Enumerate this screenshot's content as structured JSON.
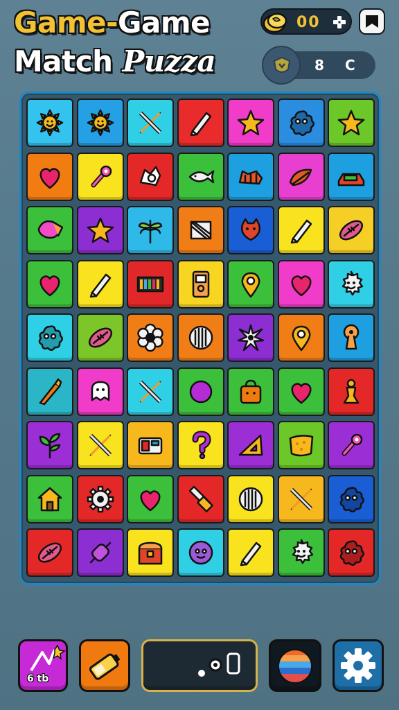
{
  "header": {
    "title_line1_a": "Game-",
    "title_line1_b": "Game",
    "title_line2_a": "Match ",
    "title_line2_b": "Puzza",
    "coins": "00",
    "coin_icon": "coin-stack-icon",
    "plus_icon": "plus-icon",
    "flag_icon": "flag-icon",
    "level_badge_icon": "shield-icon",
    "level_left": "8",
    "level_right": "C"
  },
  "board": {
    "rows": 9,
    "cols": 7,
    "tiles": [
      [
        "#34c3ee",
        "sun"
      ],
      [
        "#26a0e4",
        "sun"
      ],
      [
        "#2fd0e6",
        "cross-tools"
      ],
      [
        "#e92b2b",
        "pencil"
      ],
      [
        "#f03cc8",
        "star"
      ],
      [
        "#2a8de0",
        "blob"
      ],
      [
        "#6cc728",
        "star"
      ],
      [
        "#f17d12",
        "heart"
      ],
      [
        "#f9e21e",
        "wrench"
      ],
      [
        "#e42828",
        "dragon"
      ],
      [
        "#3cbf3a",
        "fish"
      ],
      [
        "#1e9fe0",
        "dog"
      ],
      [
        "#e83fd0",
        "leaf"
      ],
      [
        "#1e9fe0",
        "car"
      ],
      [
        "#3cbf3a",
        "shell"
      ],
      [
        "#8d2ed2",
        "star"
      ],
      [
        "#2fb9e8",
        "dragonfly"
      ],
      [
        "#f07d16",
        "box"
      ],
      [
        "#1a5ed6",
        "cat"
      ],
      [
        "#f9e21e",
        "pencil"
      ],
      [
        "#f5cf25",
        "football"
      ],
      [
        "#3cbf3a",
        "heart"
      ],
      [
        "#f9e21e",
        "pencil"
      ],
      [
        "#e12828",
        "bars"
      ],
      [
        "#f7d521",
        "phone"
      ],
      [
        "#3cbf3a",
        "pin"
      ],
      [
        "#f03cc8",
        "heart"
      ],
      [
        "#2fd0e6",
        "gear-face"
      ],
      [
        "#2fd0e6",
        "blob"
      ],
      [
        "#7cc62a",
        "football"
      ],
      [
        "#f07d16",
        "flower"
      ],
      [
        "#f07d16",
        "grill"
      ],
      [
        "#8d2ed2",
        "burst"
      ],
      [
        "#f07d16",
        "pin"
      ],
      [
        "#1e9fe0",
        "keyhole"
      ],
      [
        "#2bb6c8",
        "crayon"
      ],
      [
        "#f03cc8",
        "ghost"
      ],
      [
        "#2fd0e6",
        "cross-tools"
      ],
      [
        "#3cbf3a",
        "circle"
      ],
      [
        "#3cbf3a",
        "bag"
      ],
      [
        "#3cbf3a",
        "heart"
      ],
      [
        "#e42828",
        "chess"
      ],
      [
        "#9c2ed6",
        "plant"
      ],
      [
        "#f9e21e",
        "cross-tools"
      ],
      [
        "#f7b81e",
        "radio"
      ],
      [
        "#f9e21e",
        "question"
      ],
      [
        "#9c2ed6",
        "triangle"
      ],
      [
        "#6cc728",
        "sponge"
      ],
      [
        "#9c2ed6",
        "wrench"
      ],
      [
        "#3cbf3a",
        "house"
      ],
      [
        "#e42828",
        "gear"
      ],
      [
        "#3cbf3a",
        "heart"
      ],
      [
        "#e42828",
        "knife"
      ],
      [
        "#f9e21e",
        "grill"
      ],
      [
        "#f7b81e",
        "cross-tools"
      ],
      [
        "#1a5ed6",
        "blob"
      ],
      [
        "#e42828",
        "football"
      ],
      [
        "#8d2ed2",
        "candy"
      ],
      [
        "#f9e21e",
        "chest"
      ],
      [
        "#2fd0e6",
        "face"
      ],
      [
        "#f9e21e",
        "pencil"
      ],
      [
        "#3cbf3a",
        "gear-face"
      ],
      [
        "#e42828",
        "blob"
      ]
    ]
  },
  "toolbar": {
    "b1_label": "6 tb",
    "b1_icon": "wand-icon",
    "b2_icon": "battery-icon",
    "b3_icon": "dots-icon",
    "b4_icon": "planet-icon",
    "b5_icon": "gear-icon"
  }
}
